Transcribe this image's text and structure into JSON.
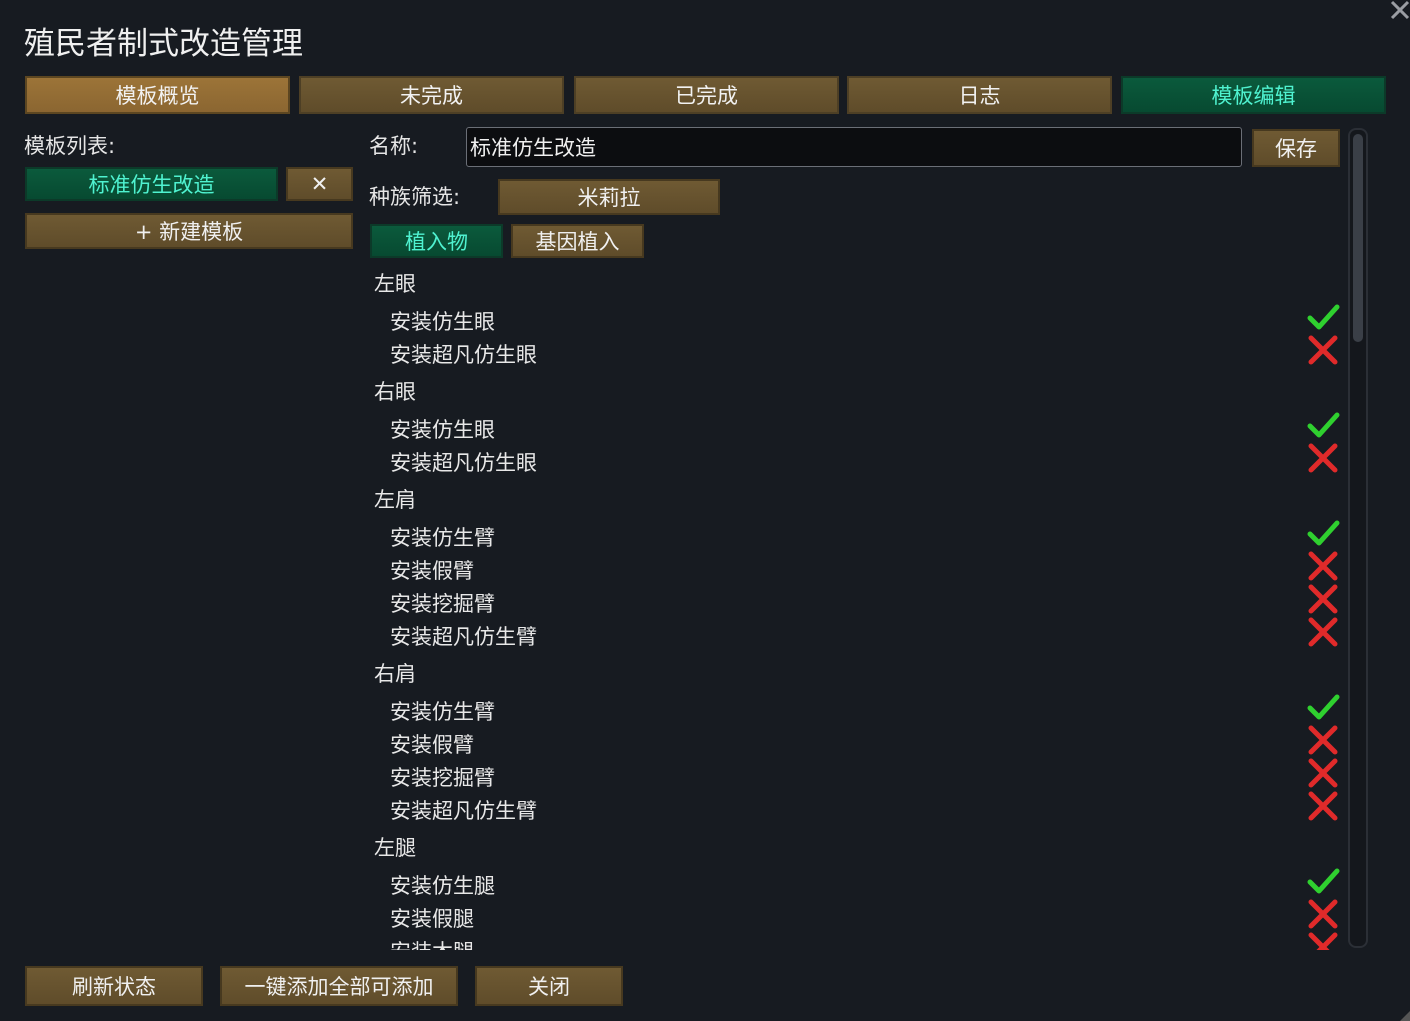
{
  "window": {
    "title": "殖民者制式改造管理"
  },
  "tabs": [
    {
      "label": "模板概览"
    },
    {
      "label": "未完成"
    },
    {
      "label": "已完成"
    },
    {
      "label": "日志"
    },
    {
      "label": "模板编辑"
    }
  ],
  "left_panel": {
    "heading": "模板列表:",
    "template_item": "标准仿生改造",
    "delete_label": "✕",
    "new_template_label": "+ 新建模板"
  },
  "editor": {
    "name_label": "名称:",
    "name_value": "标准仿生改造",
    "save_label": "保存",
    "race_label": "种族筛选:",
    "race_value": "米莉拉",
    "subtab_implants": "植入物",
    "subtab_genes": "基因植入"
  },
  "groups": [
    {
      "title": "左眼",
      "items": [
        {
          "label": "安装仿生眼",
          "state": "check"
        },
        {
          "label": "安装超凡仿生眼",
          "state": "cross"
        }
      ]
    },
    {
      "title": "右眼",
      "items": [
        {
          "label": "安装仿生眼",
          "state": "check"
        },
        {
          "label": "安装超凡仿生眼",
          "state": "cross"
        }
      ]
    },
    {
      "title": "左肩",
      "items": [
        {
          "label": "安装仿生臂",
          "state": "check"
        },
        {
          "label": "安装假臂",
          "state": "cross"
        },
        {
          "label": "安装挖掘臂",
          "state": "cross"
        },
        {
          "label": "安装超凡仿生臂",
          "state": "cross"
        }
      ]
    },
    {
      "title": "右肩",
      "items": [
        {
          "label": "安装仿生臂",
          "state": "check"
        },
        {
          "label": "安装假臂",
          "state": "cross"
        },
        {
          "label": "安装挖掘臂",
          "state": "cross"
        },
        {
          "label": "安装超凡仿生臂",
          "state": "cross"
        }
      ]
    },
    {
      "title": "左腿",
      "items": [
        {
          "label": "安装仿生腿",
          "state": "check"
        },
        {
          "label": "安装假腿",
          "state": "cross"
        },
        {
          "label": "安装木腿",
          "state": "cross"
        }
      ]
    }
  ],
  "bottom": {
    "refresh_label": "刷新状态",
    "add_all_label": "一键添加全部可添加",
    "close_label": "关闭"
  },
  "colors": {
    "check": "#2fd02f",
    "cross": "#e02a2a",
    "accent_green": "#074a31",
    "button_brown": "#6f5a33"
  },
  "icons": {
    "check": "check-icon",
    "cross": "cross-icon",
    "close": "close-icon"
  }
}
